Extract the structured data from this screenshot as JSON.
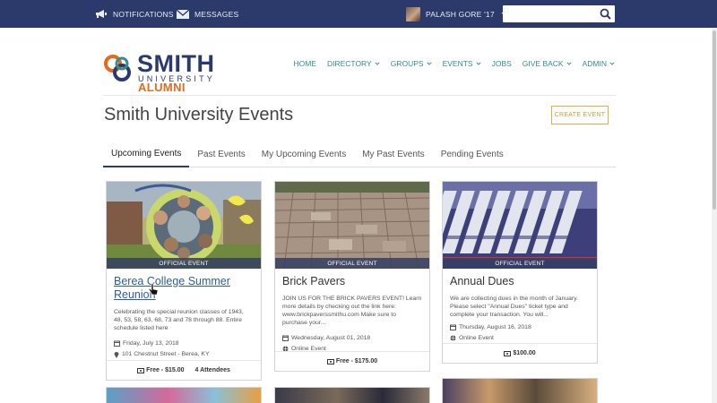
{
  "topbar": {
    "notifications": "NOTIFICATIONS",
    "messages": "MESSAGES",
    "user": "PALASH GORE '17",
    "search_placeholder": ""
  },
  "logo": {
    "smith": "SMITH",
    "university": "UNIVERSITY",
    "alumni": "ALUMNI"
  },
  "nav": [
    "HOME",
    "DIRECTORY",
    "GROUPS",
    "EVENTS",
    "JOBS",
    "GIVE BACK",
    "ADMIN"
  ],
  "page": {
    "title": "Smith University Events",
    "create_button": "CREATE EVENT"
  },
  "tabs": [
    "Upcoming Events",
    "Past Events",
    "My Upcoming Events",
    "My Past Events",
    "Pending Events"
  ],
  "cards": [
    {
      "badge": "OFFICIAL EVENT",
      "title": "Berea College Summer Reunion",
      "description": "Celebrating the special reunion classes of 1943, 48, 53, 58, 63, 68, 73 and 78 through 88.    Entire schedule listed here",
      "date": "Friday, July 13, 2018",
      "location": "101 Chestnut Street - Berea, KY",
      "price": "Free - $15.00",
      "attendees": "4 Attendees"
    },
    {
      "badge": "OFFICIAL EVENT",
      "title": "Brick Pavers",
      "description": "JOIN US FOR THE BRICK PAVERS EVENT! Learn more details by checking out the link here: www.brickpaverssmithu.com Make sure to purchase your...",
      "date": "Wednesday, August 01, 2018",
      "location": "Online Event",
      "price": "Free - $175.00"
    },
    {
      "badge": "OFFICIAL EVENT",
      "title": "Annual Dues",
      "description": "We are collecting dues in the month of January.  Please select \"Annual Dues\" ticket type and complete your transaction.  You will...",
      "date": "Thursday, August 16, 2018",
      "location": "Online Event",
      "price": "$100.00"
    }
  ],
  "colors": {
    "topbar": "#2b3a6b",
    "nav": "#3b8b8b",
    "accent_gold": "#c9a23a",
    "alumni_orange": "#e26b1e",
    "link": "#2b5e9a"
  },
  "icons": [
    "megaphone-icon",
    "envelope-icon",
    "chevron-down-icon",
    "search-icon",
    "calendar-icon",
    "map-marker-icon",
    "globe-icon",
    "ticket-icon"
  ]
}
